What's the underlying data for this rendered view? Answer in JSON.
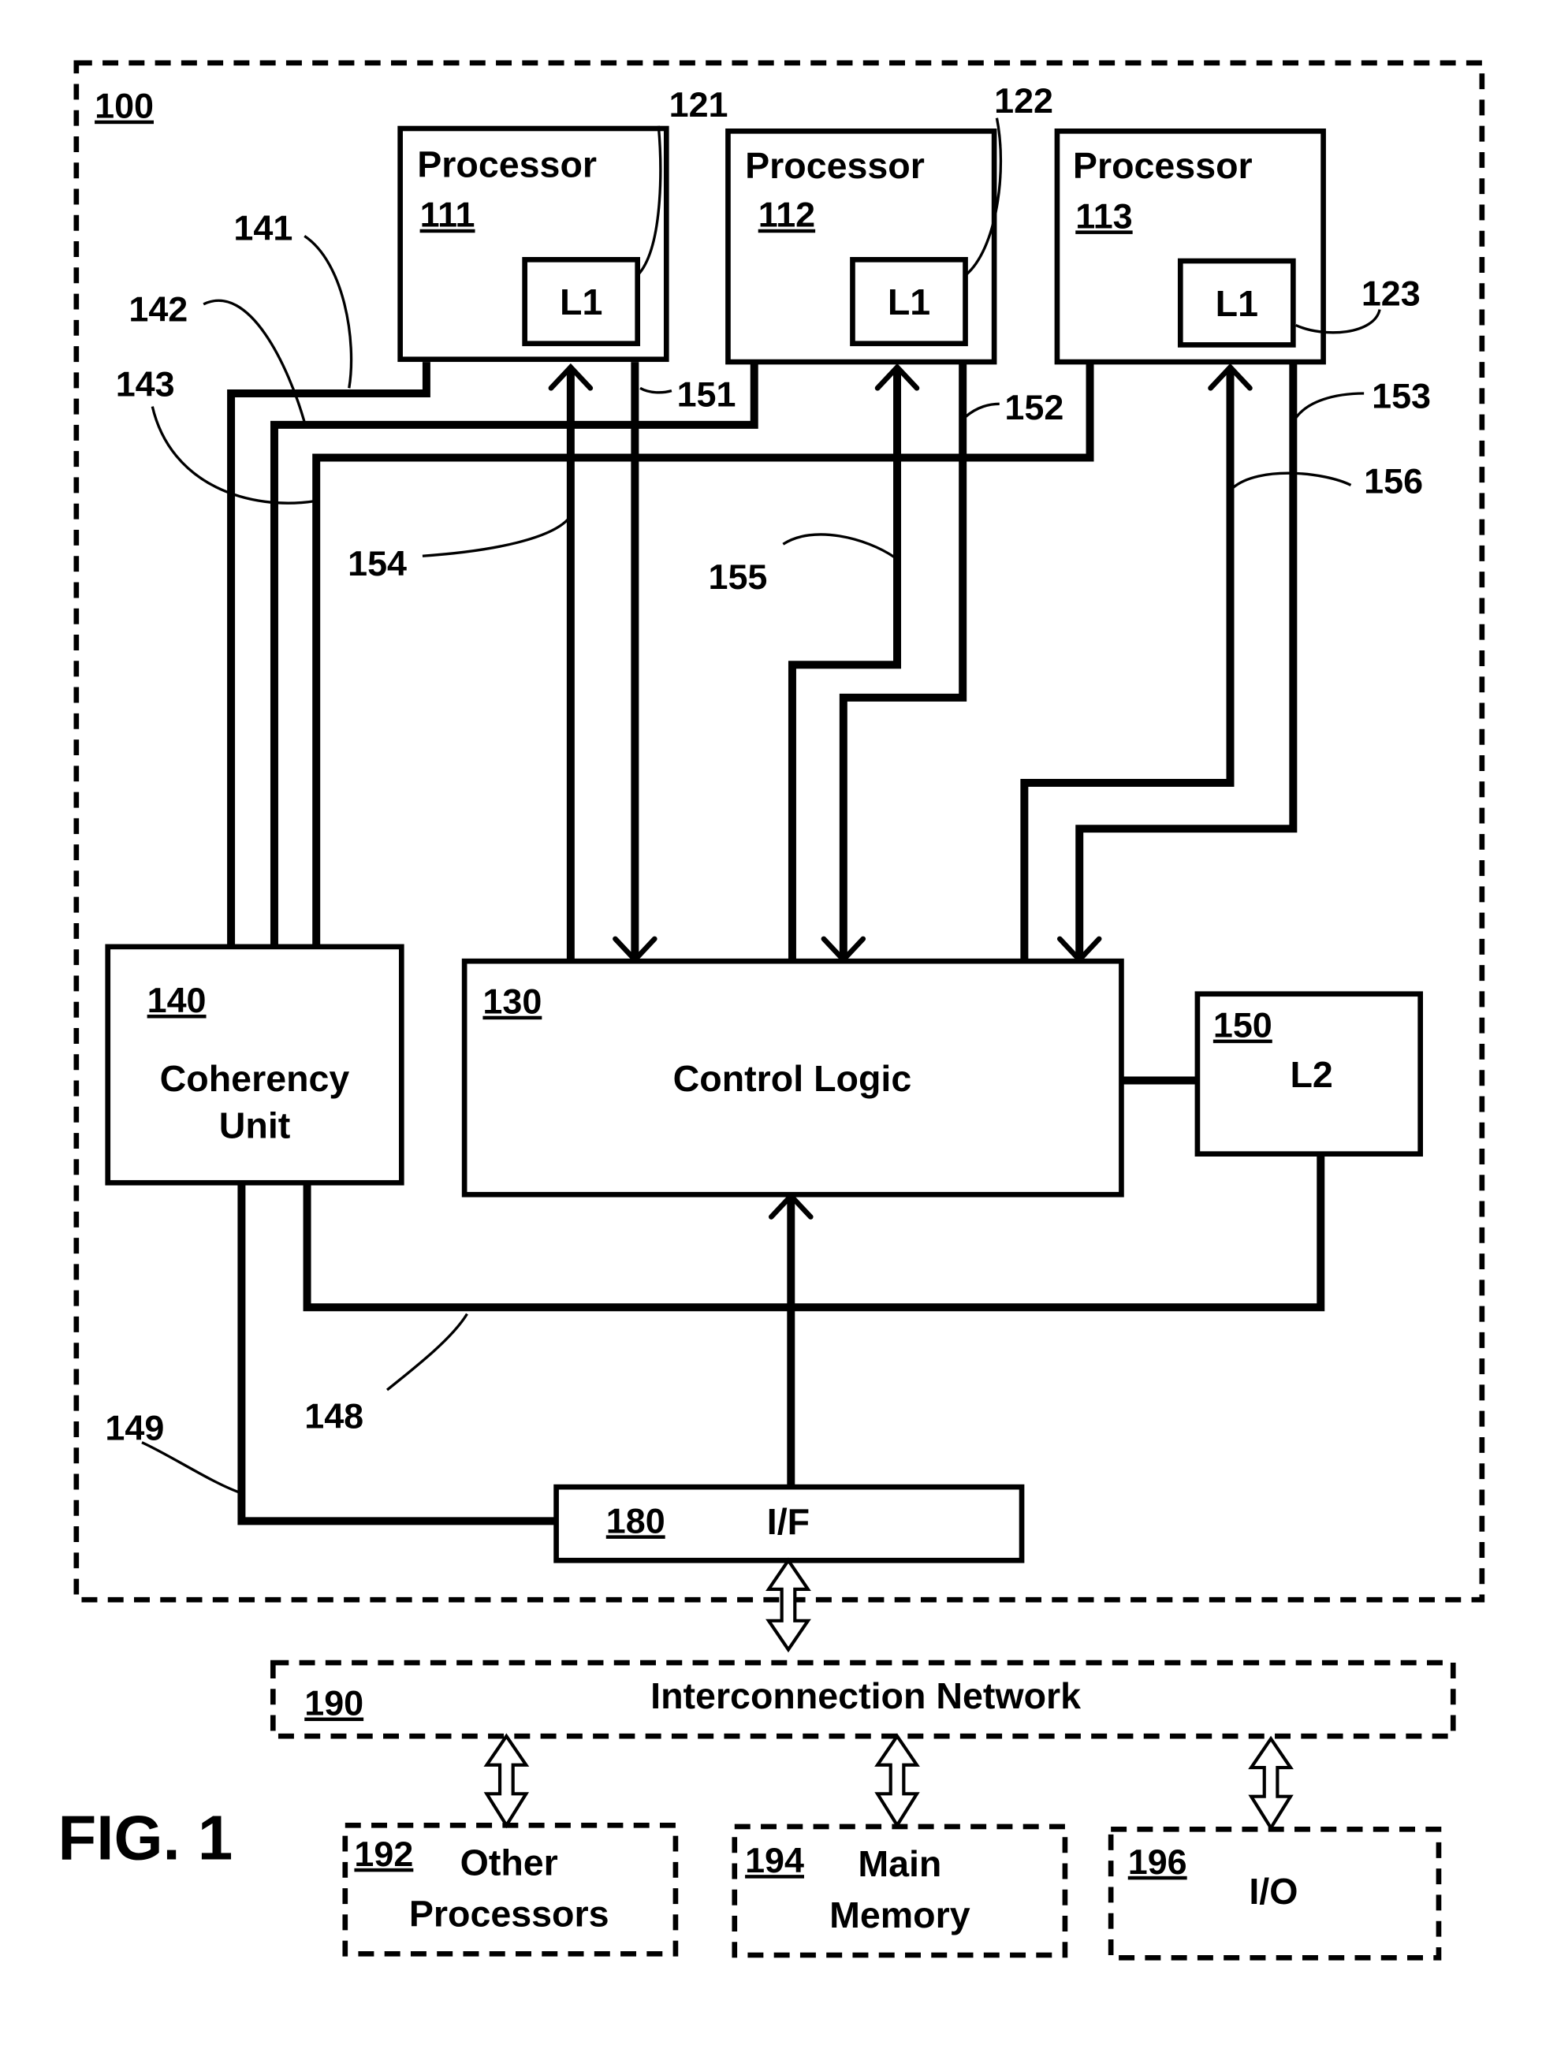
{
  "figure": {
    "title": "FIG. 1",
    "system_ref": "100"
  },
  "processors": [
    {
      "label": "Processor",
      "ref": "111",
      "cache_label": "L1",
      "cache_ref": "121"
    },
    {
      "label": "Processor",
      "ref": "112",
      "cache_label": "L1",
      "cache_ref": "122"
    },
    {
      "label": "Processor",
      "ref": "113",
      "cache_label": "L1",
      "cache_ref": "123"
    }
  ],
  "coherency_unit": {
    "ref": "140",
    "line1": "Coherency",
    "line2": "Unit"
  },
  "control_logic": {
    "ref": "130",
    "label": "Control Logic"
  },
  "l2_cache": {
    "ref": "150",
    "label": "L2"
  },
  "interface": {
    "ref": "180",
    "label": "I/F"
  },
  "network": {
    "ref": "190",
    "label": "Interconnection Network"
  },
  "external": [
    {
      "ref": "192",
      "line1": "Other",
      "line2": "Processors"
    },
    {
      "ref": "194",
      "line1": "Main",
      "line2": "Memory"
    },
    {
      "ref": "196",
      "line1": "I/O",
      "line2": ""
    }
  ],
  "connection_refs": {
    "c141": "141",
    "c142": "142",
    "c143": "143",
    "c148": "148",
    "c149": "149",
    "c151": "151",
    "c152": "152",
    "c153": "153",
    "c154": "154",
    "c155": "155",
    "c156": "156"
  }
}
